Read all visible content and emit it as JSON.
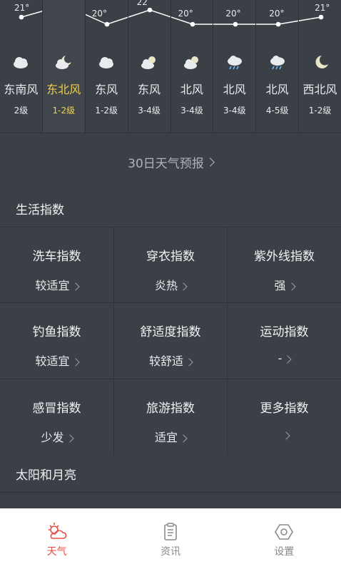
{
  "forecast": {
    "days": [
      {
        "temp": "21°",
        "icon": "cloudy-day-icon",
        "wind_dir": "东南风",
        "wind_level": "2级"
      },
      {
        "temp": "",
        "icon": "partly-cloudy-moon-icon",
        "wind_dir": "东北风",
        "wind_level": "1-2级",
        "today": true
      },
      {
        "temp": "20°",
        "icon": "cloudy-day-icon",
        "wind_dir": "东风",
        "wind_level": "1-2级"
      },
      {
        "temp": "22",
        "icon": "partly-cloudy-sun-icon",
        "wind_dir": "东风",
        "wind_level": "3-4级"
      },
      {
        "temp": "20°",
        "icon": "partly-cloudy-sun-icon",
        "wind_dir": "北风",
        "wind_level": "3-4级"
      },
      {
        "temp": "20°",
        "icon": "rain-cloud-icon",
        "wind_dir": "北风",
        "wind_level": "3-4级"
      },
      {
        "temp": "20°",
        "icon": "rain-cloud-icon",
        "wind_dir": "北风",
        "wind_level": "4-5级"
      },
      {
        "temp": "21°",
        "icon": "moon-icon",
        "wind_dir": "西北风",
        "wind_level": "1-2级"
      }
    ],
    "accent_color": "#f2cf4f"
  },
  "month_forecast": {
    "label": "30日天气预报"
  },
  "life_index": {
    "title": "生活指数",
    "items": [
      {
        "name": "洗车指数",
        "value": "较适宜"
      },
      {
        "name": "穿衣指数",
        "value": "炎热"
      },
      {
        "name": "紫外线指数",
        "value": "强"
      },
      {
        "name": "钓鱼指数",
        "value": "较适宜"
      },
      {
        "name": "舒适度指数",
        "value": "较舒适"
      },
      {
        "name": "运动指数",
        "value": "-"
      },
      {
        "name": "感冒指数",
        "value": "少发"
      },
      {
        "name": "旅游指数",
        "value": "适宜"
      },
      {
        "name": "更多指数",
        "value": ""
      }
    ]
  },
  "sun_moon": {
    "title": "太阳和月亮"
  },
  "navbar": {
    "items": [
      {
        "label": "天气",
        "icon": "weather-sun-cloud-icon",
        "active": true
      },
      {
        "label": "资讯",
        "icon": "clipboard-icon"
      },
      {
        "label": "设置",
        "icon": "settings-hexagon-icon"
      }
    ],
    "active_color": "#e94c44"
  }
}
